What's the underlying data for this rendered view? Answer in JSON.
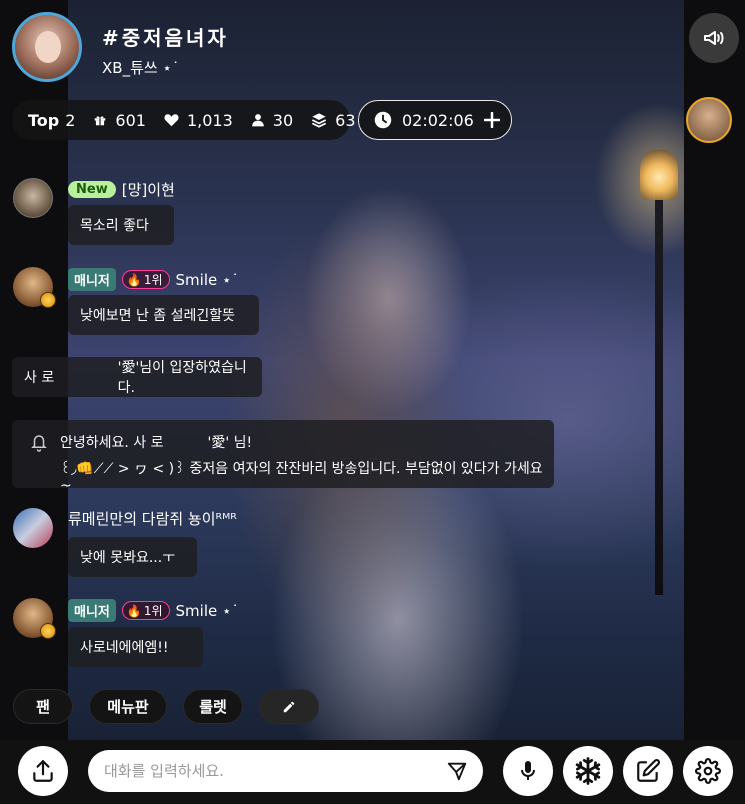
{
  "stream": {
    "title": "#중저음녀자",
    "streamer": "XB_튜쓰 ⋆˙",
    "rank_label": "Top",
    "rank_value": "2",
    "gifts": "601",
    "likes": "1,013",
    "viewers": "30",
    "stack": "63",
    "duration": "02:02:06"
  },
  "chat": [
    {
      "badge": "New",
      "name": "[먕]이현",
      "message": "목소리 좋다"
    },
    {
      "role": "매니저",
      "rank": "1위",
      "name": "Smile ⋆˙",
      "message": "낮에보면 난 좀 설레긴할뜻"
    },
    {
      "system_name": "사 로",
      "system_text": "'愛'님이 입장하였습니다."
    },
    {
      "notice_line1_a": "안녕하세요. 사 로",
      "notice_line1_b": "'愛' 님!",
      "notice_line2": "꒰◞👊⟋⟋ > ヮ < )꒱ 중저음 여자의 잔잔바리 방송입니다. 부담없이 있다가 가세요~"
    },
    {
      "name": "류메린만의 다람쥐 뇽이ᴿᴹᴿ",
      "message": "낮에 못봐요...ㅜ"
    },
    {
      "role": "매니저",
      "rank": "1위",
      "name": "Smile ⋆˙",
      "message": "사로네에에엠!!"
    }
  ],
  "quick_menu": [
    "팬",
    "메뉴판",
    "룰렛"
  ],
  "input": {
    "placeholder": "대화를 입력하세요."
  },
  "icons": {
    "megaphone": "megaphone-icon",
    "gift": "gift-icon",
    "heart": "heart-icon",
    "user": "user-icon",
    "layers": "layers-icon",
    "clock": "clock-icon",
    "plus": "plus-icon",
    "bell": "bell-icon",
    "pencil": "pencil-icon",
    "share": "share-icon",
    "send": "send-icon",
    "mic": "mic-icon",
    "snowflake": "snowflake-icon",
    "edit": "edit-icon",
    "settings": "gear-icon"
  },
  "colors": {
    "avatar_ring": "#4fa7d9",
    "new_tag": "#b9f09b",
    "manager_tag": "#3a7a74",
    "rank_border": "#ff3d96"
  }
}
